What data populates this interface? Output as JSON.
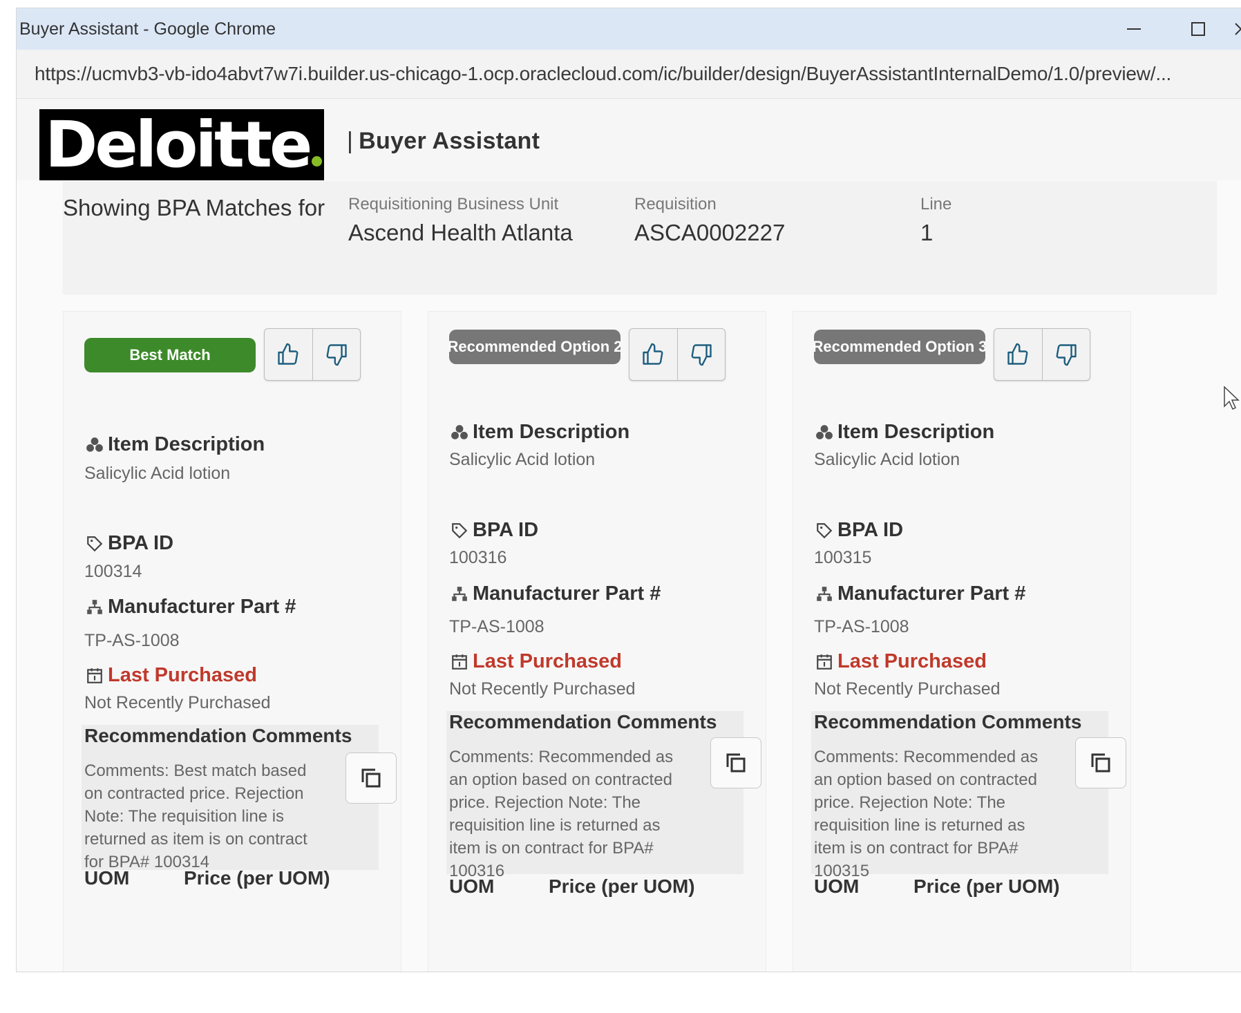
{
  "window": {
    "title": "Buyer Assistant - Google Chrome",
    "url": "https://ucmvb3-vb-ido4abvt7w7i.builder.us-chicago-1.ocp.oraclecloud.com/ic/builder/design/BuyerAssistantInternalDemo/1.0/preview/..."
  },
  "header": {
    "logo_text": "Deloitte",
    "app_separator": "|",
    "app_title": "Buyer Assistant"
  },
  "context": {
    "heading": "Showing BPA Matches for",
    "fields": [
      {
        "label": "Requisitioning Business Unit",
        "value": "Ascend Health Atlanta"
      },
      {
        "label": "Requisition",
        "value": "ASCA0002227"
      },
      {
        "label": "Line",
        "value": "1"
      }
    ]
  },
  "labels": {
    "item_description": "Item Description",
    "bpa_id": "BPA ID",
    "manufacturer_part": "Manufacturer Part #",
    "last_purchased": "Last Purchased",
    "recommendation_comments": "Recommendation Comments",
    "uom": "UOM",
    "price": "Price (per UOM)"
  },
  "cards": [
    {
      "badge": "Best Match",
      "item_description": "Salicylic Acid lotion",
      "bpa_id": "100314",
      "manufacturer_part": "TP-AS-1008",
      "last_purchased": "Not Recently Purchased",
      "comments": "Comments: Best match based on contracted price. Rejection Note: The requisition line is returned as item is on contract for BPA# 100314"
    },
    {
      "badge": "Recommended Option 2",
      "item_description": "Salicylic Acid lotion",
      "bpa_id": "100316",
      "manufacturer_part": "TP-AS-1008",
      "last_purchased": "Not Recently Purchased",
      "comments": "Comments: Recommended as an option based on contracted price. Rejection Note: The requisition line is returned as item is on contract for BPA# 100316"
    },
    {
      "badge": "Recommended Option 3",
      "item_description": "Salicylic Acid lotion",
      "bpa_id": "100315",
      "manufacturer_part": "TP-AS-1008",
      "last_purchased": "Not Recently Purchased",
      "comments": "Comments: Recommended as an option based on contracted price. Rejection Note: The requisition line is returned as item is on contract for BPA# 100315"
    }
  ],
  "colors": {
    "best_match": "#3d8a2a",
    "recommended": "#777777",
    "last_purchased": "#c0392b",
    "brand_green": "#86bc25"
  },
  "icons": [
    "minimize-icon",
    "maximize-icon",
    "close-icon",
    "thumbs-up-icon",
    "thumbs-down-icon",
    "items-icon",
    "tag-icon",
    "hierarchy-icon",
    "calendar-icon",
    "copy-icon",
    "cursor-icon"
  ]
}
